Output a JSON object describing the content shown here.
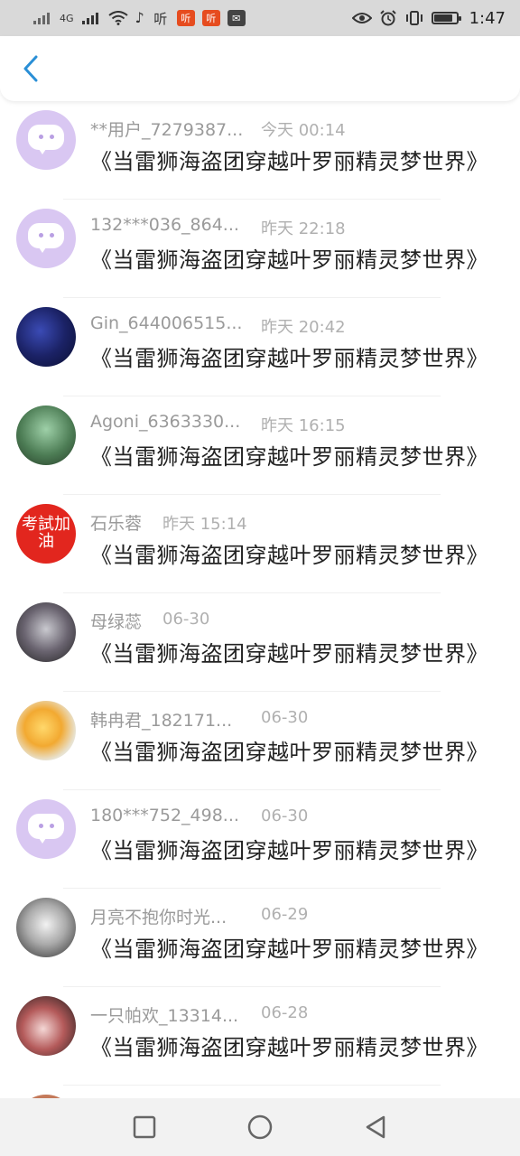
{
  "status_bar": {
    "network_label": "4G",
    "app_icon_1": "听",
    "app_icon_2": "听",
    "app_icon_3": "听",
    "time": "1:47",
    "battery_level": 0.85
  },
  "header": {
    "back_icon": "chevron-left-icon",
    "accent_color": "#2a8fd6"
  },
  "comments": [
    {
      "user": "**用户_7279387...",
      "time": "今天 00:14",
      "text": "《当雷狮海盗团穿越叶罗丽精灵梦世界》",
      "avatar": "default-chat-avatar"
    },
    {
      "user": "132***036_864...",
      "time": "昨天 22:18",
      "text": "《当雷狮海盗团穿越叶罗丽精灵梦世界》",
      "avatar": "default-chat-avatar"
    },
    {
      "user": "Gin_644006515...",
      "time": "昨天 20:42",
      "text": "《当雷狮海盗团穿越叶罗丽精灵梦世界》",
      "avatar": "photo-avatar"
    },
    {
      "user": "Agoni_6363330...",
      "time": "昨天 16:15",
      "text": "《当雷狮海盗团穿越叶罗丽精灵梦世界》",
      "avatar": "photo-avatar"
    },
    {
      "user": "石乐蓉",
      "time": "昨天 15:14",
      "text": "《当雷狮海盗团穿越叶罗丽精灵梦世界》",
      "avatar": "red-text-avatar",
      "avatar_text": "考試加油"
    },
    {
      "user": "母绿蕊",
      "time": "06-30",
      "text": "《当雷狮海盗团穿越叶罗丽精灵梦世界》",
      "avatar": "photo-avatar"
    },
    {
      "user": "韩冉君_182171...",
      "time": "06-30",
      "text": "《当雷狮海盗团穿越叶罗丽精灵梦世界》",
      "avatar": "photo-avatar"
    },
    {
      "user": "180***752_498...",
      "time": "06-30",
      "text": "《当雷狮海盗团穿越叶罗丽精灵梦世界》",
      "avatar": "default-chat-avatar"
    },
    {
      "user": "月亮不抱你时光...",
      "time": "06-29",
      "text": "《当雷狮海盗团穿越叶罗丽精灵梦世界》",
      "avatar": "photo-avatar"
    },
    {
      "user": "一只帕欢_13314...",
      "time": "06-28",
      "text": "《当雷狮海盗团穿越叶罗丽精灵梦世界》",
      "avatar": "photo-avatar"
    }
  ],
  "nav_bar": {
    "recent_icon": "square-icon",
    "home_icon": "circle-icon",
    "back_icon": "triangle-back-icon"
  }
}
